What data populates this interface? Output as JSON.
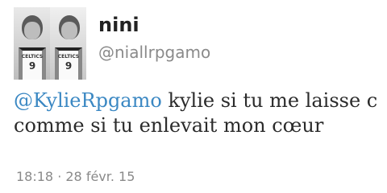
{
  "author": {
    "name": "nini",
    "handle": "@niallrpgamo",
    "avatar": {
      "left_jersey_text": "CELTICS",
      "left_jersey_number": "9",
      "right_jersey_text": "CELTICS",
      "right_jersey_number": "9"
    }
  },
  "tweet": {
    "mention": "@KylieRpgamo",
    "body": " kylie si tu me laisse c comme si tu enlevait mon cœur"
  },
  "meta": {
    "time": "18:18",
    "separator": " · ",
    "date": "28 févr. 15"
  },
  "colors": {
    "mention": "#3b88c3",
    "name": "#222222",
    "secondary": "#8a8a8a",
    "body": "#2b2b2b"
  }
}
